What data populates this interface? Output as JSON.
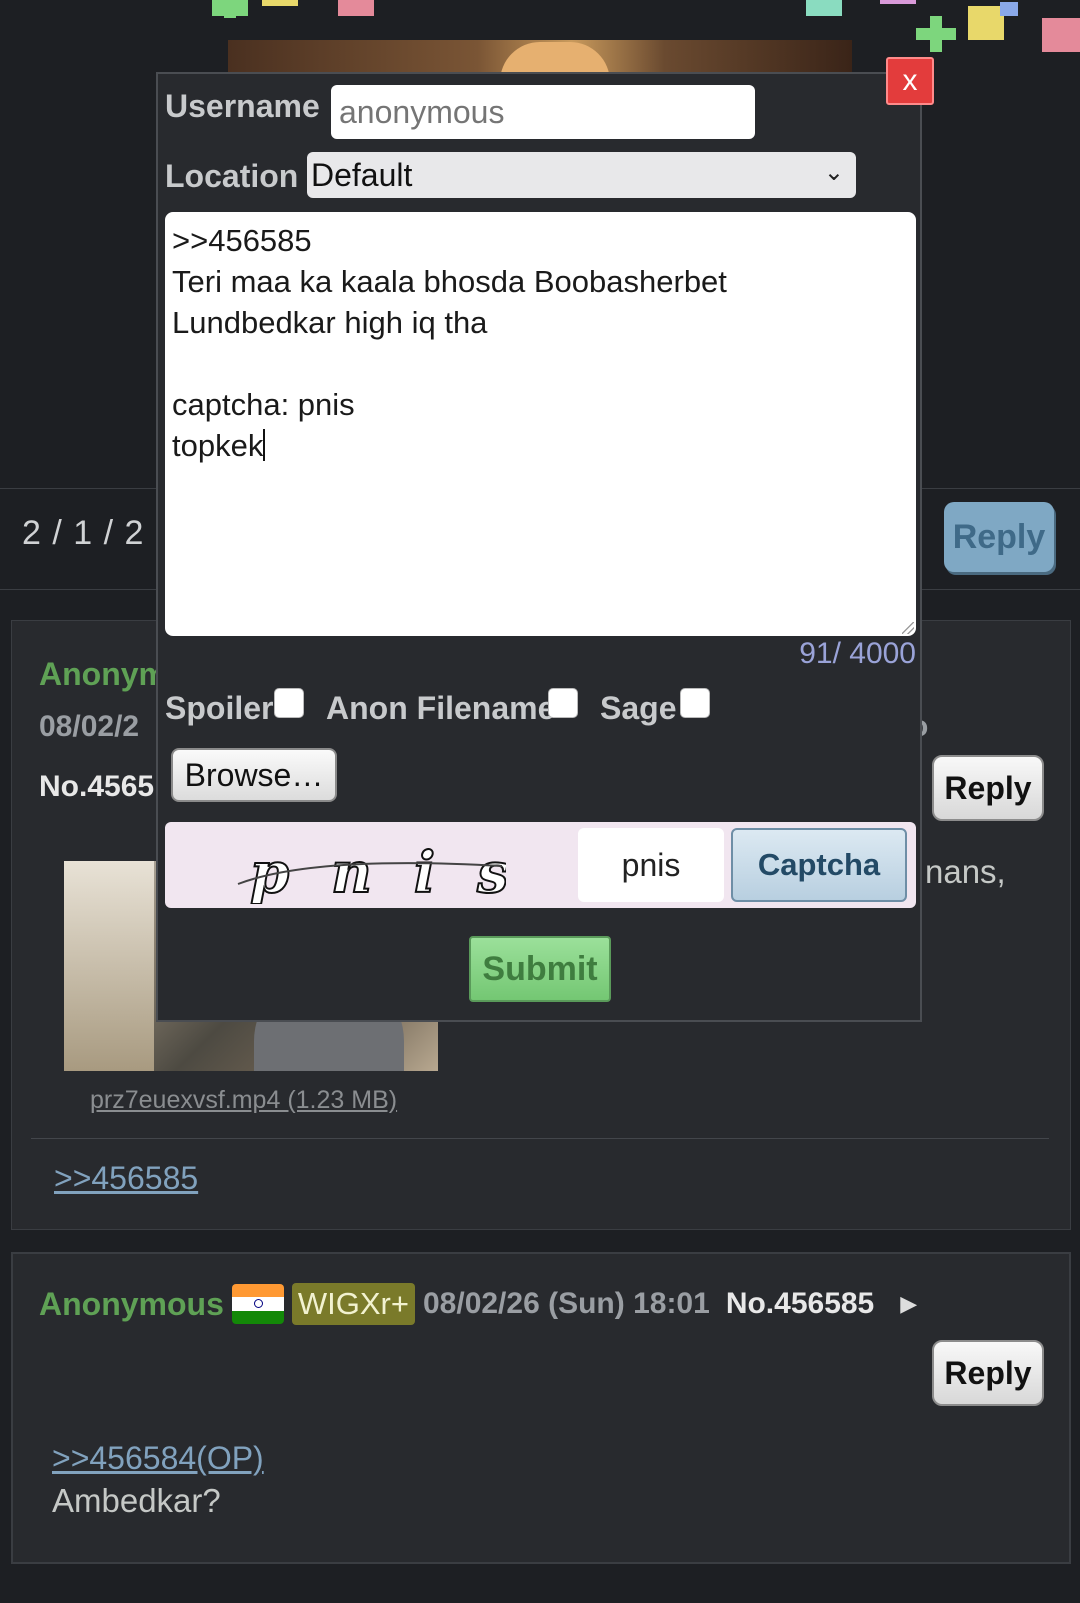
{
  "form": {
    "username_label": "Username",
    "username_placeholder": "anonymous",
    "location_label": "Location",
    "location_value": "Default",
    "comment_text": ">>456585\nTeri maa ka kaala bhosda Boobasherbet\nLundbedkar high iq tha\n\ncaptcha: pnis\ntopkek",
    "char_count": "91/ 4000",
    "spoiler_label": "Spoiler",
    "anon_filename_label": "Anon Filename",
    "sage_label": "Sage",
    "browse_label": "Browse…",
    "captcha_image_text": "pnis",
    "captcha_value": "pnis",
    "captcha_button": "Captcha",
    "submit_label": "Submit",
    "close_label": "x"
  },
  "thread_bar": {
    "page_counter": "2 / 1 / 2",
    "reply_label": "Reply"
  },
  "post1": {
    "name": "Anonym",
    "date_partial": "08/02/2",
    "no_partial": "No.4565",
    "tail_char": "o",
    "reply_label": "Reply",
    "body_partial_1": "nans,",
    "filename": "prz7euexvsf.mp4 (1.23 MB)",
    "quote": ">>456585"
  },
  "post2": {
    "name": "Anonymous",
    "id_badge": "WIGXr+",
    "date": "08/02/26 (Sun) 18:01",
    "no": "No.456585",
    "arrow": "▶",
    "reply_label": "Reply",
    "quote": ">>456584(OP)",
    "body": "Ambedkar?"
  },
  "colors": {
    "background": "#1d1f23",
    "post_bg": "#282a2e",
    "name_green": "#5fa155",
    "link_blue": "#81a2be",
    "close_red": "#e33c3c",
    "submit_green": "#74c773"
  },
  "icons": [
    "close-icon",
    "chevron-down-icon",
    "play-arrow-icon",
    "india-flag-icon"
  ]
}
